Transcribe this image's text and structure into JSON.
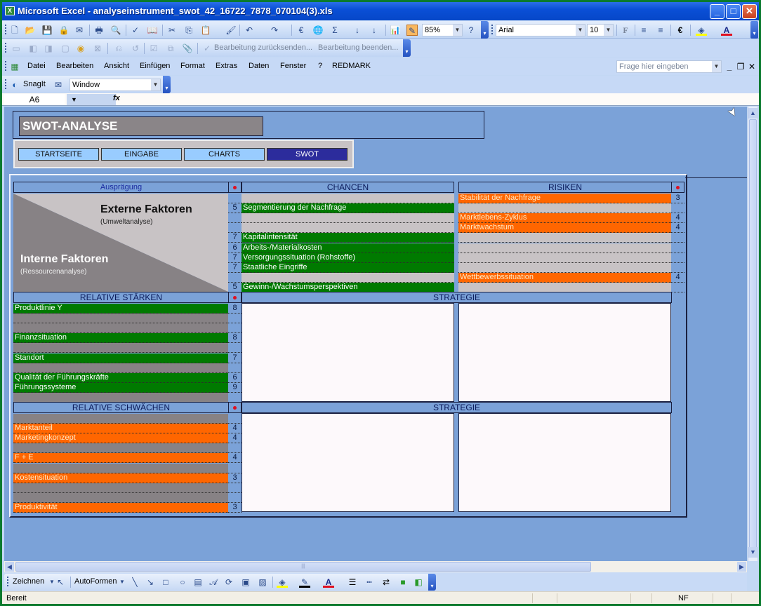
{
  "window": {
    "title": "Microsoft Excel - analyseinstrument_swot_42_16722_7878_070104(3).xls",
    "app_icon": "excel-icon",
    "controls": {
      "minimize": "_",
      "maximize": "□",
      "close": "✕"
    }
  },
  "toolbar_standard": {
    "zoom": "85%",
    "font": "Arial",
    "font_size": "10",
    "bold_label": "F",
    "euro_label": "€"
  },
  "toolbar_review": {
    "send_back": "Bearbeitung zurücksenden...",
    "end_review": "Bearbeitung beenden..."
  },
  "menu": {
    "items": [
      "Datei",
      "Bearbeiten",
      "Ansicht",
      "Einfügen",
      "Format",
      "Extras",
      "Daten",
      "Fenster",
      "?",
      "REDMARK"
    ],
    "help_placeholder": "Frage hier eingeben"
  },
  "snagit": {
    "label": "SnagIt",
    "mode": "Window"
  },
  "formula_bar": {
    "cell_ref": "A6",
    "fx": "fx",
    "value": ""
  },
  "sheet": {
    "title": "SWOT-ANALYSE",
    "nav": [
      {
        "label": "STARTSEITE",
        "active": false
      },
      {
        "label": "EINGABE",
        "active": false
      },
      {
        "label": "CHARTS",
        "active": false
      },
      {
        "label": "SWOT",
        "active": true
      }
    ],
    "auspraegung_label": "Ausprägung",
    "externe": {
      "title": "Externe Faktoren",
      "sub": "(Umweltanalyse)"
    },
    "interne": {
      "title": "Interne Faktoren",
      "sub": "(Ressourcenanalyse)"
    },
    "chancen": {
      "header": "CHANCEN",
      "rows": [
        {
          "score": "",
          "label": ""
        },
        {
          "score": "5",
          "label": "Segmentierung der Nachfrage"
        },
        {
          "score": "",
          "label": ""
        },
        {
          "score": "",
          "label": ""
        },
        {
          "score": "7",
          "label": "Kapitalintensität"
        },
        {
          "score": "6",
          "label": "Arbeits-/Materialkosten"
        },
        {
          "score": "7",
          "label": "Versorgungssituation (Rohstoffe)"
        },
        {
          "score": "7",
          "label": "Staatliche Eingriffe"
        },
        {
          "score": "",
          "label": ""
        },
        {
          "score": "5",
          "label": "Gewinn-/Wachstumsperspektiven"
        }
      ]
    },
    "risiken": {
      "header": "RISIKEN",
      "rows": [
        {
          "score": "3",
          "label": "Stabilität der Nachfrage"
        },
        {
          "score": "",
          "label": ""
        },
        {
          "score": "4",
          "label": "Marktlebens-Zyklus"
        },
        {
          "score": "4",
          "label": "Marktwachstum"
        },
        {
          "score": "",
          "label": ""
        },
        {
          "score": "",
          "label": ""
        },
        {
          "score": "",
          "label": ""
        },
        {
          "score": "",
          "label": ""
        },
        {
          "score": "4",
          "label": "Wettbewerbssituation"
        },
        {
          "score": "",
          "label": ""
        }
      ]
    },
    "staerken": {
      "header": "RELATIVE STÄRKEN",
      "rows": [
        {
          "score": "8",
          "label": "Produktlinie Y"
        },
        {
          "score": "",
          "label": ""
        },
        {
          "score": "",
          "label": ""
        },
        {
          "score": "8",
          "label": "Finanzsituation"
        },
        {
          "score": "",
          "label": ""
        },
        {
          "score": "7",
          "label": "Standort"
        },
        {
          "score": "",
          "label": ""
        },
        {
          "score": "6",
          "label": "Qualität der Führungskräfte"
        },
        {
          "score": "9",
          "label": "Führungssysteme"
        },
        {
          "score": "",
          "label": ""
        }
      ]
    },
    "schwaechen": {
      "header": "RELATIVE SCHWÄCHEN",
      "rows": [
        {
          "score": "",
          "label": ""
        },
        {
          "score": "4",
          "label": "Marktanteil"
        },
        {
          "score": "4",
          "label": "Marketingkonzept"
        },
        {
          "score": "",
          "label": ""
        },
        {
          "score": "4",
          "label": "F + E"
        },
        {
          "score": "",
          "label": ""
        },
        {
          "score": "3",
          "label": "Kostensituation"
        },
        {
          "score": "",
          "label": ""
        },
        {
          "score": "",
          "label": ""
        },
        {
          "score": "3",
          "label": "Produktivität"
        }
      ]
    },
    "strategie_label": "STRATEGIE"
  },
  "drawing_toolbar": {
    "draw_label": "Zeichnen",
    "autoshapes_label": "AutoFormen"
  },
  "status_bar": {
    "status": "Bereit",
    "nf": "NF"
  },
  "colors": {
    "chance_strength": "#007a00",
    "risk_weakness": "#ff6600",
    "header_blue": "#7ba2d8",
    "active_nav": "#2c2c9c",
    "nav_button": "#99ccff"
  }
}
